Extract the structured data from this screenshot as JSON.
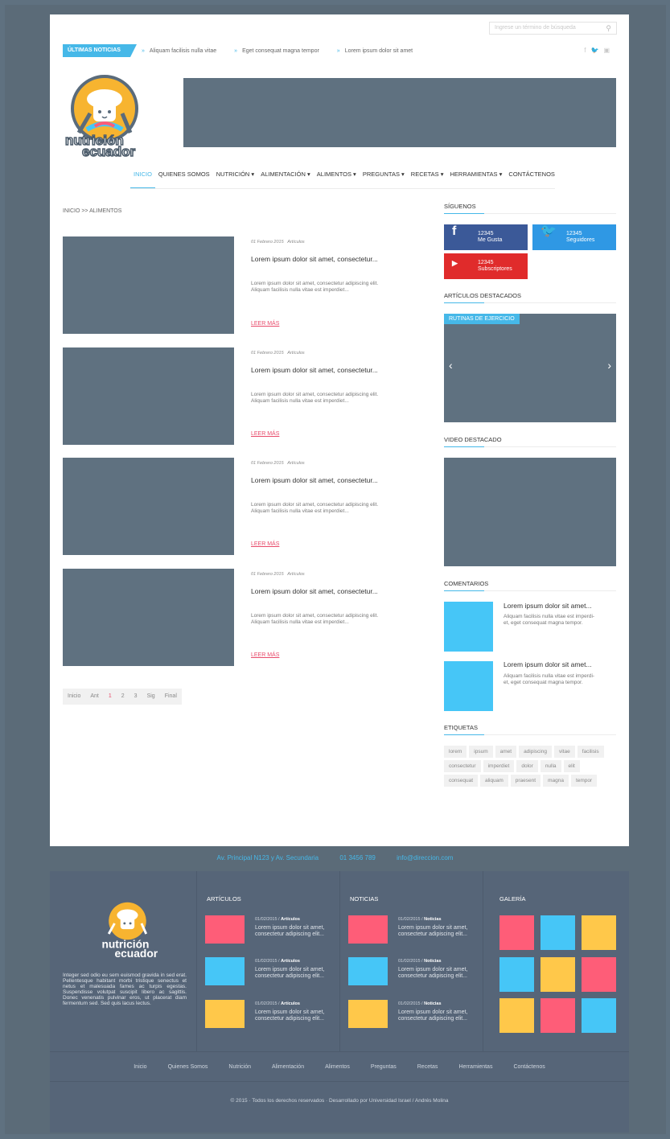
{
  "search": {
    "placeholder": "Ingrese un término de búsqueda"
  },
  "ticker": {
    "label": "ÚLTIMAS NOTICIAS",
    "items": [
      "Aliquam facilisis nulla vitae",
      "Eget consequat magna tempor",
      "Lorem ipsum dolor sit amet"
    ]
  },
  "logo": {
    "line1": "nutrición",
    "line2": "ecuador"
  },
  "nav": [
    "INICIO",
    "QUIENES SOMOS",
    "NUTRICIÓN ▾",
    "ALIMENTACIÓN ▾",
    "ALIMENTOS ▾",
    "PREGUNTAS ▾",
    "RECETAS ▾",
    "HERRAMIENTAS ▾",
    "CONTÁCTENOS"
  ],
  "breadcrumb": "INICIO >> ALIMENTOS",
  "articles": [
    {
      "date": "01 Febrero 2015",
      "category": "Artículos",
      "title": "Lorem ipsum dolor sit amet, consectetur...",
      "text1": "Lorem ipsum dolor sit amet, consectetur adipiscing elit.",
      "text2": "Aliquam facilisis nulla vitae est imperdiet...",
      "more": "LEER MÁS"
    },
    {
      "date": "01 Febrero 2015",
      "category": "Artículos",
      "title": "Lorem ipsum dolor sit amet, consectetur...",
      "text1": "Lorem ipsum dolor sit amet, consectetur adipiscing elit.",
      "text2": "Aliquam facilisis nulla vitae est imperdiet...",
      "more": "LEER MÁS"
    },
    {
      "date": "01 Febrero 2015",
      "category": "Artículos",
      "title": "Lorem ipsum dolor sit amet, consectetur...",
      "text1": "Lorem ipsum dolor sit amet, consectetur adipiscing elit.",
      "text2": "Aliquam facilisis nulla vitae est imperdiet...",
      "more": "LEER MÁS"
    },
    {
      "date": "01 Febrero 2015",
      "category": "Artículos",
      "title": "Lorem ipsum dolor sit amet, consectetur...",
      "text1": "Lorem ipsum dolor sit amet, consectetur adipiscing elit.",
      "text2": "Aliquam facilisis nulla vitae est imperdiet...",
      "more": "LEER MÁS"
    }
  ],
  "pager": [
    "Inicio",
    "Ant",
    "1",
    "2",
    "3",
    "Sig",
    "Final"
  ],
  "sidebar": {
    "follow": "SÍGUENOS",
    "facebook": {
      "count": "12345",
      "label": "Me Gusta",
      "color": "#3b5998"
    },
    "twitter": {
      "count": "12345",
      "label": "Seguidores",
      "color": "#2f98e4"
    },
    "youtube": {
      "count": "12345",
      "label": "Subscriptores",
      "color": "#e02b2b"
    },
    "featured_title": "ARTÍCULOS DESTACADOS",
    "featured_tag": "RUTINAS DE EJERCICIO",
    "video_title": "VIDEO DESTACADO",
    "comments_title": "COMENTARIOS",
    "comments": [
      {
        "title": "Lorem ipsum dolor sit amet...",
        "t1": "Aliquam facilisis nulla vitae est imperdi-",
        "t2": "et, eget consequat magna tempor."
      },
      {
        "title": "Lorem ipsum dolor sit amet...",
        "t1": "Aliquam facilisis nulla vitae est imperdi-",
        "t2": "et, eget consequat magna tempor."
      }
    ],
    "tags_title": "ETIQUETAS",
    "tags": [
      "lorem",
      "ipsum",
      "amet",
      "adipiscing",
      "vitae",
      "facilisis",
      "consectetur",
      "imperdiet",
      "dolor",
      "nulla",
      "elit",
      "consequat",
      "aliquam",
      "praesent",
      "magna",
      "tempor"
    ]
  },
  "contact": {
    "address": "Av. Principal N123 y Av. Secundaria",
    "phone": "01 3456 789",
    "email": "info@direccion.com"
  },
  "footer": {
    "description": "Integer sed odio eu sem euismod gravida in sed erat. Pellentesque habitant morbi tristique senectus et netus et malesuada fames ac turpis egestas. Suspendisse volutpat suscipit libero ac sagittis. Donec venenatis pulvinar eros, ut placerat diam fermentum sed. Sed quis lacus lectus.",
    "articles_title": "ARTÍCULOS",
    "news_title": "NOTICIAS",
    "gallery_title": "GALERÍA",
    "articles": [
      {
        "date": "01/02/2015 / ",
        "cat": "Artículos",
        "t1": "Lorem ipsum dolor sit amet,",
        "t2": "consectetur adipiscing elit..."
      },
      {
        "date": "01/02/2015 / ",
        "cat": "Artículos",
        "t1": "Lorem ipsum dolor sit amet,",
        "t2": "consectetur adipiscing elit..."
      },
      {
        "date": "01/02/2015 / ",
        "cat": "Artículos",
        "t1": "Lorem ipsum dolor sit amet,",
        "t2": "consectetur adipiscing elit..."
      }
    ],
    "news": [
      {
        "date": "01/02/2015 / ",
        "cat": "Noticias",
        "t1": "Lorem ipsum dolor sit amet,",
        "t2": "consectetur adipiscing elit..."
      },
      {
        "date": "01/02/2015 / ",
        "cat": "Noticias",
        "t1": "Lorem ipsum dolor sit amet,",
        "t2": "consectetur adipiscing elit..."
      },
      {
        "date": "01/02/2015 / ",
        "cat": "Noticias",
        "t1": "Lorem ipsum dolor sit amet,",
        "t2": "consectetur adipiscing elit..."
      }
    ],
    "nav": [
      "Inicio",
      "Quienes Somos",
      "Nutrición",
      "Alimentación",
      "Alimentos",
      "Preguntas",
      "Recetas",
      "Herramientas",
      "Contáctenos"
    ],
    "copyright": "© 2015 · Todos los derechos reservados · Desarrollado por Universidad Israel / Andrés Molina"
  },
  "colors": {
    "red": "#fe5d78",
    "blue": "#46c6f7",
    "yellow": "#ffc84a"
  }
}
